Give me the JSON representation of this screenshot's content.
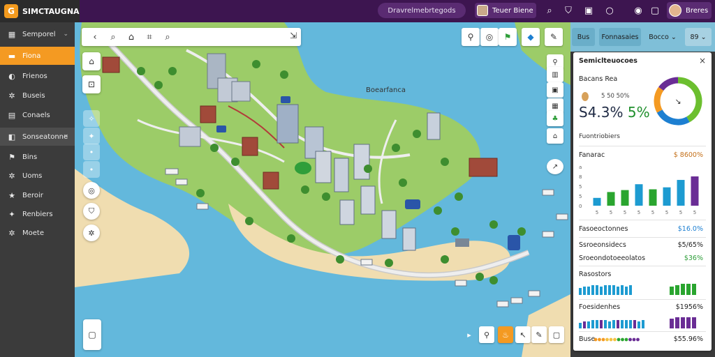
{
  "app": {
    "title": "SIMCTAUGNA",
    "logo_glyph": "G"
  },
  "topbar": {
    "search_placeholder": "Dravrelmebrtegods",
    "user_name": "Teuer Biene",
    "profile_name": "Breres",
    "icons": [
      "search-icon",
      "bookmark-icon",
      "calendar-icon",
      "circle-icon",
      "compass-icon",
      "window-icon"
    ]
  },
  "sidebar": {
    "items": [
      {
        "label": "Semporel",
        "icon": "grid-icon",
        "chevron": "⌄",
        "state": "normal"
      },
      {
        "label": "Fiona",
        "icon": "folder-icon",
        "state": "active"
      },
      {
        "label": "Frienos",
        "icon": "drop-icon",
        "state": "normal"
      },
      {
        "label": "Buseis",
        "icon": "gear-icon",
        "state": "normal"
      },
      {
        "label": "Conaels",
        "icon": "list-icon",
        "state": "normal"
      },
      {
        "label": "Sonseatonne",
        "icon": "layers-icon",
        "chevron": "×",
        "state": "highlight"
      },
      {
        "label": "Bins",
        "icon": "flag-icon",
        "state": "normal"
      },
      {
        "label": "Uoms",
        "icon": "gear-icon",
        "state": "normal"
      },
      {
        "label": "Beroir",
        "icon": "star-icon",
        "state": "normal"
      },
      {
        "label": "Renbiers",
        "icon": "sparkle-icon",
        "state": "normal"
      },
      {
        "label": "Moete",
        "icon": "gear-icon",
        "state": "normal"
      }
    ]
  },
  "map": {
    "place_label": "Boearfanca",
    "toolbar_icons": [
      "back-icon",
      "search-icon",
      "home-icon",
      "bookmark-icon",
      "search-icon"
    ],
    "accent_green": "#2f9e3a",
    "accent_orange": "#f49a22"
  },
  "right_tabs": [
    {
      "label": "Bus"
    },
    {
      "label": "Fonnasaies"
    },
    {
      "label": "Bocco",
      "chevron": "⌄"
    },
    {
      "label": "89",
      "chevron": "⌄"
    }
  ],
  "panel": {
    "title": "Semiclteuocoes",
    "close": "×",
    "subtitle": "Bacans Rea",
    "sub_value": "5 50 50%",
    "big_value": "S4.3%",
    "big_pct": "5%",
    "caption": "Fuontriobiers",
    "donut": {
      "segments": [
        0.42,
        0.25,
        0.18,
        0.15
      ],
      "colors": [
        "#6cbf2f",
        "#1d7fd1",
        "#f49a22",
        "#6a2d95"
      ]
    },
    "section1": {
      "label": "Fanarac",
      "value": "$ 8600%"
    },
    "chart_data": {
      "type": "bar",
      "ylabel": "",
      "ylim": [
        0,
        10
      ],
      "y_ticks": [
        "a",
        "8",
        "5",
        "5",
        "0"
      ],
      "categories": [
        "5",
        "5",
        "5",
        "5",
        "5",
        "5",
        "5",
        "5"
      ],
      "series": [
        {
          "values": [
            2,
            3.5,
            4,
            5.5,
            4.2,
            4.7,
            6.6,
            7.5
          ],
          "colors": [
            "#1d9bd1",
            "#2aa52f",
            "#2aa52f",
            "#1d9bd1",
            "#2aa52f",
            "#1d9bd1",
            "#1d9bd1",
            "#6a2d95"
          ]
        }
      ]
    },
    "rows": [
      {
        "label": "Fasoeoctonnes",
        "value": "$16.0%",
        "value_color": "#1d7fd1"
      },
      {
        "label": "Ssroeonsidecs",
        "value": "$5/65%",
        "value_color": "#333333"
      },
      {
        "label": "Sroeondotoeeolatos",
        "value": "$36%",
        "value_color": "#2f9e3a"
      },
      {
        "label": "Rasostors",
        "value": "",
        "value_color": "#333333"
      },
      {
        "label": "Foesidenhes",
        "value": "$1956%",
        "value_color": "#333333"
      },
      {
        "label": "Buse",
        "value": "$55.96%",
        "value_color": "#333333"
      }
    ],
    "mini1": {
      "values": [
        5,
        6,
        6,
        7,
        7,
        6,
        7,
        7,
        7,
        6,
        7,
        6,
        7
      ],
      "color": "#1d9bd1"
    },
    "mini1b": {
      "values": [
        6,
        7,
        8,
        8,
        8
      ],
      "color": "#2aa52f"
    },
    "mini2": {
      "values": [
        4,
        5,
        5,
        6,
        6,
        6,
        6,
        5,
        6,
        6,
        6,
        6,
        6,
        6,
        5,
        6
      ],
      "colors": "mixed"
    },
    "mini2b": {
      "values": [
        7,
        8,
        8,
        8,
        8
      ],
      "color": "#6a2d95"
    },
    "dots": {
      "count": 12,
      "colors": [
        "#f49a22",
        "#f4c142",
        "#2aa52f",
        "#6a2d95"
      ]
    }
  }
}
